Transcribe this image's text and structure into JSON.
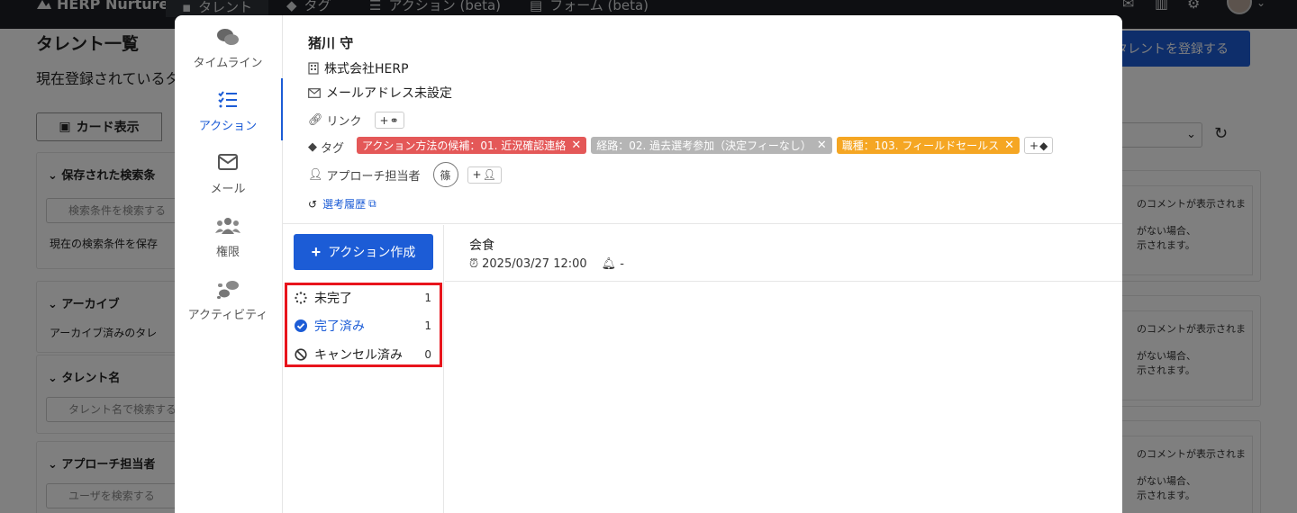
{
  "topnav": {
    "brand": "HERP Nurture",
    "items": [
      {
        "label": "タレント",
        "icon": "id-card-icon"
      },
      {
        "label": "タグ",
        "icon": "tag-icon"
      },
      {
        "label": "アクション (beta)",
        "icon": "list-check-icon"
      },
      {
        "label": "フォーム (beta)",
        "icon": "form-icon"
      }
    ]
  },
  "background": {
    "title": "タレント一覧",
    "subtitle": "現在登録されているタ",
    "register_button": "タレントを登録する",
    "view_button": "カード表示",
    "saved_search_header": "保存された検索条",
    "saved_search_placeholder": "検索条件を検索する",
    "save_current": "現在の検索条件を保存",
    "archive_header": "アーカイブ",
    "archive_checkbox": "アーカイブ済みのタレ",
    "talent_name_header": "タレント名",
    "talent_name_placeholder": "タレント名で検索する",
    "approach_header": "アプローチ担当者",
    "user_placeholder": "ユーザを検索する",
    "comment_line1": "のコメントが表示されま",
    "comment_line2": "がない場合、",
    "comment_line3": "示されます。"
  },
  "modal": {
    "sidebar": [
      {
        "label": "タイムライン",
        "icon": "comments-icon"
      },
      {
        "label": "アクション",
        "icon": "list-check-icon"
      },
      {
        "label": "メール",
        "icon": "envelope-icon"
      },
      {
        "label": "権限",
        "icon": "users-icon"
      },
      {
        "label": "アクティビティ",
        "icon": "footprints-icon"
      }
    ],
    "candidate": {
      "name": "猪川 守",
      "company": "株式会社HERP",
      "email": "メールアドレス未設定",
      "link_label": "リンク",
      "tag_label": "タグ",
      "tags": [
        {
          "label": "アクション方法の候補：01. 近況確認連絡",
          "color": "#e45858"
        },
        {
          "label": "経路：02. 過去選考参加（決定フィーなし）",
          "color": "#b5b5b5"
        },
        {
          "label": "職種：103. フィールドセールス",
          "color": "#f5a623"
        }
      ],
      "approach_label": "アプローチ担当者",
      "assignee_initial": "篠",
      "history_link": "選考履歴"
    },
    "create_action_button": "アクション作成",
    "status_filters": [
      {
        "label": "未完了",
        "count": "1"
      },
      {
        "label": "完了済み",
        "count": "1"
      },
      {
        "label": "キャンセル済み",
        "count": "0"
      }
    ],
    "action": {
      "title": "会食",
      "datetime": "2025/03/27 12:00",
      "reminder": "-"
    }
  }
}
